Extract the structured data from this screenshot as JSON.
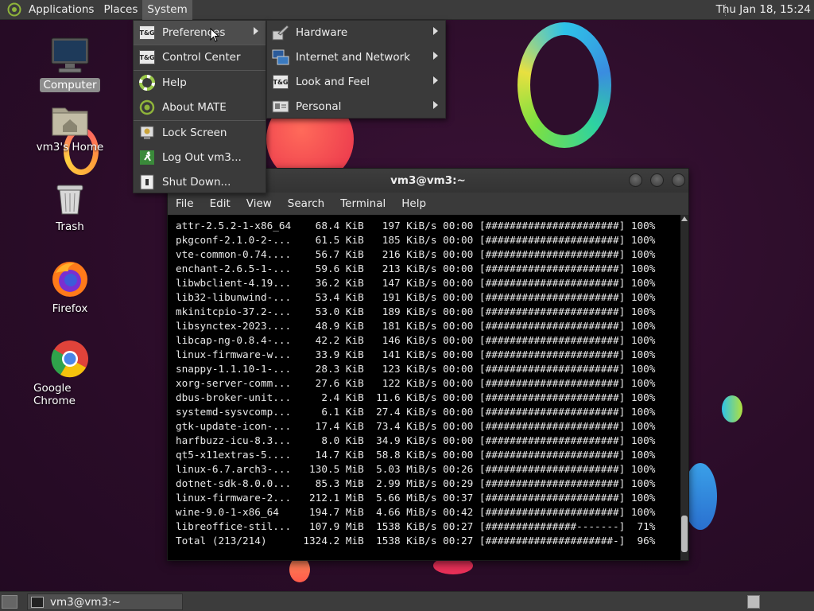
{
  "top_panel": {
    "menus": [
      "Applications",
      "Places",
      "System"
    ],
    "clock": "Thu Jan 18, 15:24"
  },
  "desktop_icons": [
    {
      "label": "Computer",
      "icon": "computer-icon"
    },
    {
      "label": "vm3's Home",
      "icon": "home-folder-icon"
    },
    {
      "label": "Trash",
      "icon": "trash-icon"
    },
    {
      "label": "Firefox",
      "icon": "firefox-icon"
    },
    {
      "label": "Google Chrome",
      "icon": "chrome-icon"
    }
  ],
  "system_menu": {
    "items": [
      "Preferences",
      "Control Center",
      "Help",
      "About MATE",
      "Lock Screen",
      "Log Out vm3...",
      "Shut Down..."
    ]
  },
  "preferences_menu": {
    "items": [
      "Hardware",
      "Internet and Network",
      "Look and Feel",
      "Personal"
    ]
  },
  "terminal": {
    "title": "vm3@vm3:~",
    "menus": [
      "File",
      "Edit",
      "View",
      "Search",
      "Terminal",
      "Help"
    ],
    "lines": [
      "attr-2.5.2-1-x86_64    68.4 KiB   197 KiB/s 00:00 [######################] 100%",
      "pkgconf-2.1.0-2-...    61.5 KiB   185 KiB/s 00:00 [######################] 100%",
      "vte-common-0.74....    56.7 KiB   216 KiB/s 00:00 [######################] 100%",
      "enchant-2.6.5-1-...    59.6 KiB   213 KiB/s 00:00 [######################] 100%",
      "libwbclient-4.19...    36.2 KiB   147 KiB/s 00:00 [######################] 100%",
      "lib32-libunwind-...    53.4 KiB   191 KiB/s 00:00 [######################] 100%",
      "mkinitcpio-37.2-...    53.0 KiB   189 KiB/s 00:00 [######################] 100%",
      "libsynctex-2023....    48.9 KiB   181 KiB/s 00:00 [######################] 100%",
      "libcap-ng-0.8.4-...    42.2 KiB   146 KiB/s 00:00 [######################] 100%",
      "linux-firmware-w...    33.9 KiB   141 KiB/s 00:00 [######################] 100%",
      "snappy-1.1.10-1-...    28.3 KiB   123 KiB/s 00:00 [######################] 100%",
      "xorg-server-comm...    27.6 KiB   122 KiB/s 00:00 [######################] 100%",
      "dbus-broker-unit...     2.4 KiB  11.6 KiB/s 00:00 [######################] 100%",
      "systemd-sysvcomp...     6.1 KiB  27.4 KiB/s 00:00 [######################] 100%",
      "gtk-update-icon-...    17.4 KiB  73.4 KiB/s 00:00 [######################] 100%",
      "harfbuzz-icu-8.3...     8.0 KiB  34.9 KiB/s 00:00 [######################] 100%",
      "qt5-x11extras-5....    14.7 KiB  58.8 KiB/s 00:00 [######################] 100%",
      "linux-6.7.arch3-...   130.5 MiB  5.03 MiB/s 00:26 [######################] 100%",
      "dotnet-sdk-8.0.0...    85.3 MiB  2.99 MiB/s 00:29 [######################] 100%",
      "linux-firmware-2...   212.1 MiB  5.66 MiB/s 00:37 [######################] 100%",
      "wine-9.0-1-x86_64     194.7 MiB  4.66 MiB/s 00:42 [######################] 100%",
      "libreoffice-stil...   107.9 MiB  1538 KiB/s 00:27 [###############-------]  71%",
      "Total (213/214)      1324.2 MiB  1538 KiB/s 00:27 [#####################-]  96%"
    ],
    "scroll_position": 0.97
  },
  "bottom_panel": {
    "task_label": "vm3@vm3:~"
  },
  "colors": {
    "panel": "#3c3c3c",
    "menu_bg": "#3a3a3a",
    "menu_highlight": "#4d4d4d",
    "terminal_bg": "#000000",
    "wallpaper": "#2a0c28"
  }
}
